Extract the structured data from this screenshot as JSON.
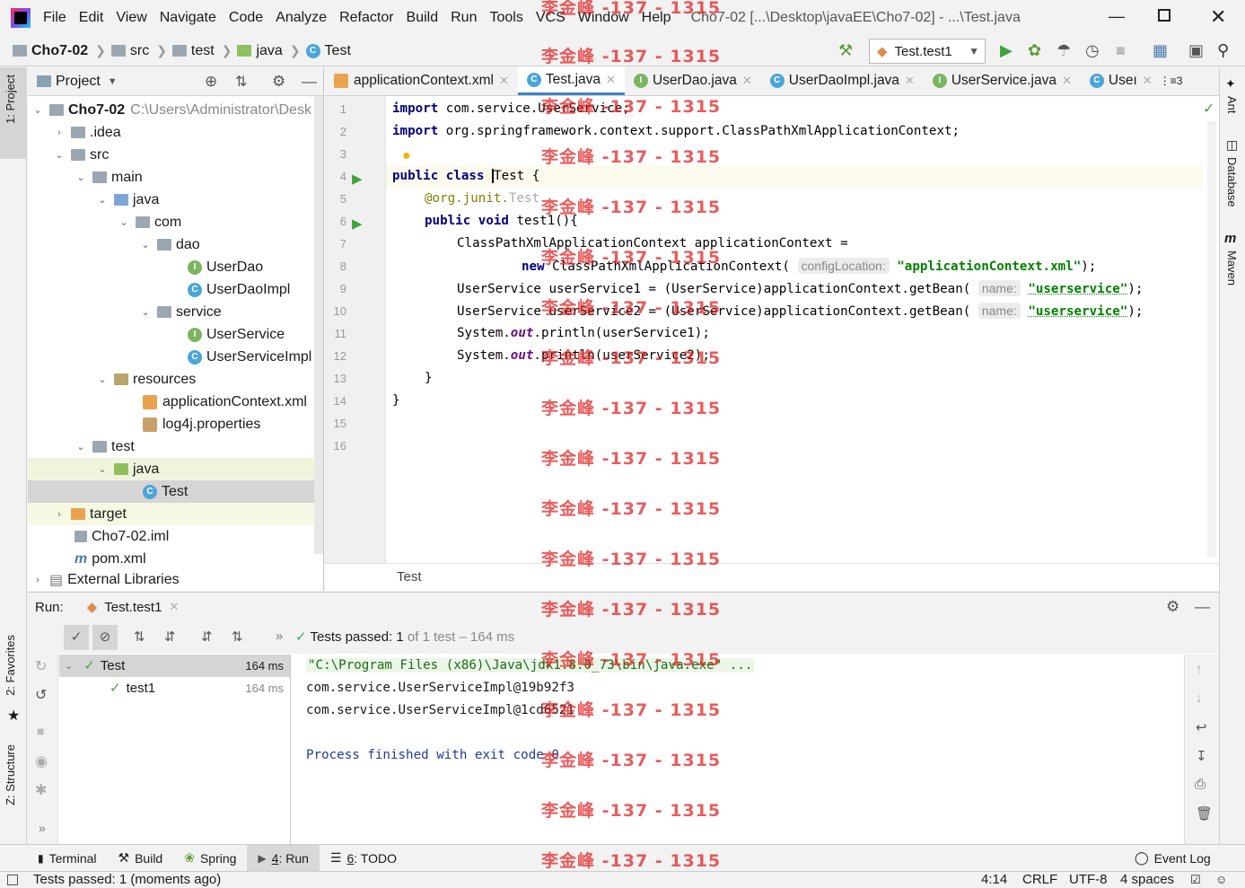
{
  "menubar": {
    "items": [
      "File",
      "Edit",
      "View",
      "Navigate",
      "Code",
      "Analyze",
      "Refactor",
      "Build",
      "Run",
      "Tools",
      "VCS",
      "Window",
      "Help"
    ],
    "window_title": "Cho7-02 [...\\Desktop\\javaEE\\Cho7-02] - ...\\Test.java"
  },
  "navbar": {
    "crumbs": [
      "Cho7-02",
      "src",
      "test",
      "java",
      "Test"
    ],
    "run_config": "Test.test1"
  },
  "left_strip": {
    "project_tab": "1: Project",
    "favorites_tab": "2: Favorites",
    "structure_tab": "Z: Structure"
  },
  "right_strip": {
    "ant": "Ant",
    "database": "Database",
    "maven": "Maven"
  },
  "project": {
    "title": "Project",
    "tree": [
      {
        "label": "Cho7-02",
        "extra": "C:\\Users\\Administrator\\Desk",
        "bold": true
      },
      {
        "label": ".idea"
      },
      {
        "label": "src"
      },
      {
        "label": "main"
      },
      {
        "label": "java"
      },
      {
        "label": "com"
      },
      {
        "label": "dao"
      },
      {
        "label": "UserDao"
      },
      {
        "label": "UserDaoImpl"
      },
      {
        "label": "service"
      },
      {
        "label": "UserService"
      },
      {
        "label": "UserServiceImpl"
      },
      {
        "label": "resources"
      },
      {
        "label": "applicationContext.xml"
      },
      {
        "label": "log4j.properties"
      },
      {
        "label": "test"
      },
      {
        "label": "java"
      },
      {
        "label": "Test"
      },
      {
        "label": "target"
      },
      {
        "label": "Cho7-02.iml"
      },
      {
        "label": "pom.xml"
      },
      {
        "label": "External Libraries"
      }
    ]
  },
  "editor": {
    "tabs": [
      "applicationContext.xml",
      "Test.java",
      "UserDao.java",
      "UserDaoImpl.java",
      "UserService.java",
      "Useı"
    ],
    "tab_overflow": "⋮≡3",
    "line_numbers": [
      "1",
      "2",
      "3",
      "4",
      "5",
      "6",
      "7",
      "8",
      "9",
      "10",
      "11",
      "12",
      "13",
      "14",
      "15",
      "16"
    ],
    "code": {
      "l1_kw": "import",
      "l1_rest": " com.service.UserService;",
      "l2_kw": "import",
      "l2_rest": " org.springframework.context.support.ClassPathXmlApplicationContext;",
      "l4_kw": "public class",
      "l4_name": "Test",
      "l4_rest": " {",
      "l5_ann": "@org.junit.",
      "l5_ann2": "Test",
      "l6_kw": "public void",
      "l6_rest": " test1(){",
      "l7": "ClassPathXmlApplicationContext applicationContext =",
      "l8_kw": "new",
      "l8_rest": " ClassPathXmlApplicationContext(",
      "l8_hint": "configLocation:",
      "l8_str": "\"applicationContext.xml\"",
      "l8_end": ");",
      "l9_pre": "UserService userService1 = (UserService)applicationContext.getBean(",
      "l9_hint": "name:",
      "l9_str": "\"userservice\"",
      "l9_end": ");",
      "l10_pre": "UserService userService2 = (UserService)applicationContext.getBean(",
      "l10_hint": "name:",
      "l10_str": "\"userservice\"",
      "l10_end": ");",
      "l11_pre": "System.",
      "l11_it": "out",
      "l11_end": ".println(userService1);",
      "l12_pre": "System.",
      "l12_it": "out",
      "l12_end": ".println(userService2);",
      "l13": "}",
      "l14": "}"
    },
    "footer": "Test"
  },
  "run": {
    "label": "Run:",
    "tab": "Test.test1",
    "status_prefix": "Tests passed:",
    "status_count": "1",
    "status_suffix": "of 1 test – 164 ms",
    "tree": [
      {
        "label": "Test",
        "time": "164 ms"
      },
      {
        "label": "test1",
        "time": "164 ms"
      }
    ],
    "console": [
      "\"C:\\Program Files (x86)\\Java\\jdk1.8.0_73\\bin\\java.exe\" ...",
      "com.service.UserServiceImpl@19b92f3",
      "com.service.UserServiceImpl@1cd6521",
      "",
      "Process finished with exit code 0"
    ]
  },
  "bottom_tabs": {
    "terminal": "Terminal",
    "build": "Build",
    "spring": "Spring",
    "run_num": "4",
    "run_label": ": Run",
    "todo_num": "6",
    "todo_label": ": TODO",
    "event_log": "Event Log"
  },
  "statusbar": {
    "message": "Tests passed: 1 (moments ago)",
    "position": "4:14",
    "line_sep": "CRLF",
    "encoding": "UTF-8",
    "indent": "4 spaces"
  },
  "watermark": "李金峰 -137 - 1315",
  "colors": {
    "accent": "#4083c9",
    "keyword": "#000080",
    "string": "#008000",
    "pass": "#4aa54a",
    "watermark": "#e01f1f"
  }
}
